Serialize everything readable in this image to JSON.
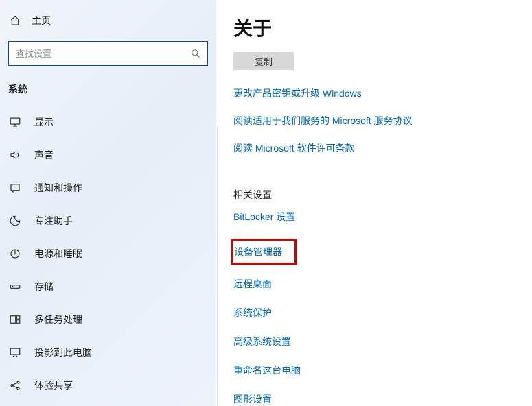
{
  "sidebar": {
    "home_label": "主页",
    "search_placeholder": "查找设置",
    "section_title": "系统",
    "items": [
      {
        "label": "显示"
      },
      {
        "label": "声音"
      },
      {
        "label": "通知和操作"
      },
      {
        "label": "专注助手"
      },
      {
        "label": "电源和睡眠"
      },
      {
        "label": "存储"
      },
      {
        "label": "多任务处理"
      },
      {
        "label": "投影到此电脑"
      },
      {
        "label": "体验共享"
      }
    ]
  },
  "main": {
    "title": "关于",
    "copy_label": "复制",
    "top_links": [
      "更改产品密钥或升级 Windows",
      "阅读适用于我们服务的 Microsoft 服务协议",
      "阅读 Microsoft 软件许可条款"
    ],
    "related_heading": "相关设置",
    "related_links": [
      "BitLocker 设置",
      "设备管理器",
      "远程桌面",
      "系统保护",
      "高级系统设置",
      "重命名这台电脑",
      "图形设置"
    ]
  }
}
